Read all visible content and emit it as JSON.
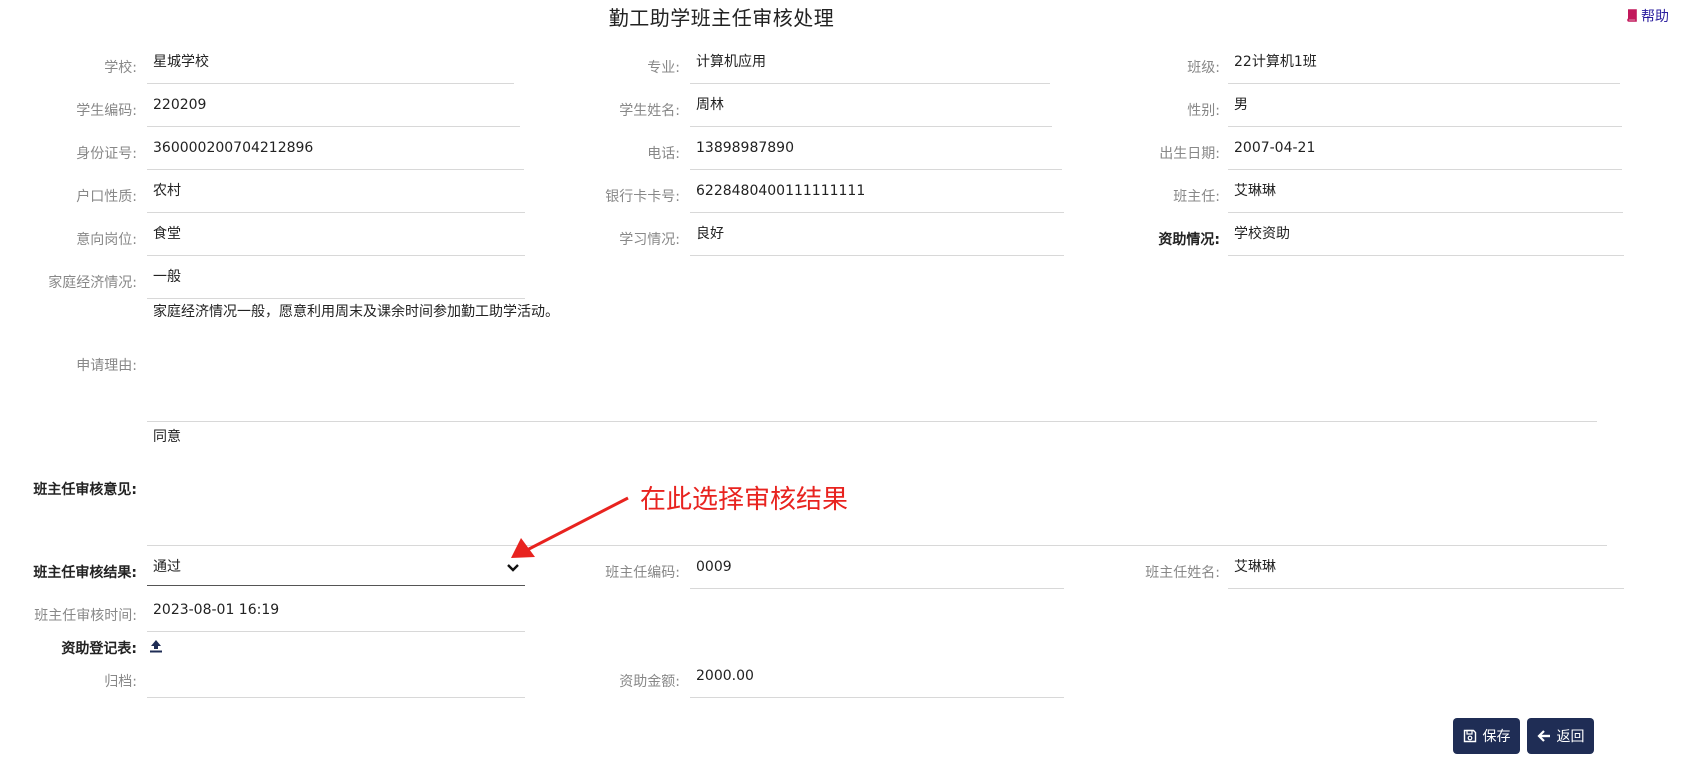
{
  "page": {
    "title": "勤工助学班主任审核处理",
    "help_label": "帮助"
  },
  "fields": {
    "school": {
      "label": "学校:",
      "value": "星城学校"
    },
    "major": {
      "label": "专业:",
      "value": "计算机应用"
    },
    "class": {
      "label": "班级:",
      "value": "22计算机1班"
    },
    "student_id": {
      "label": "学生编码:",
      "value": "220209"
    },
    "student_name": {
      "label": "学生姓名:",
      "value": "周林"
    },
    "gender": {
      "label": "性别:",
      "value": "男"
    },
    "id_card": {
      "label": "身份证号:",
      "value": "360000200704212896"
    },
    "phone": {
      "label": "电话:",
      "value": "13898987890"
    },
    "birth_date": {
      "label": "出生日期:",
      "value": "2007-04-21"
    },
    "hukou": {
      "label": "户口性质:",
      "value": "农村"
    },
    "bank_card": {
      "label": "银行卡卡号:",
      "value": "6228480400111111111"
    },
    "head_teacher": {
      "label": "班主任:",
      "value": "艾琳琳"
    },
    "intended_post": {
      "label": "意向岗位:",
      "value": "食堂"
    },
    "study_status": {
      "label": "学习情况:",
      "value": "良好"
    },
    "aid_status": {
      "label": "资助情况:",
      "value": "学校资助"
    },
    "family_economy": {
      "label": "家庭经济情况:",
      "value": "一般"
    },
    "reason": {
      "label": "申请理由:",
      "value": "家庭经济情况一般，愿意利用周末及课余时间参加勤工助学活动。"
    },
    "review_opinion": {
      "label": "班主任审核意见:",
      "value": "同意"
    },
    "review_result": {
      "label": "班主任审核结果:",
      "value": "通过"
    },
    "teacher_code": {
      "label": "班主任编码:",
      "value": "0009"
    },
    "teacher_name": {
      "label": "班主任姓名:",
      "value": "艾琳琳"
    },
    "review_time": {
      "label": "班主任审核时间:",
      "value": "2023-08-01 16:19"
    },
    "aid_form": {
      "label": "资助登记表:"
    },
    "archive": {
      "label": "归档:",
      "value": ""
    },
    "aid_amount": {
      "label": "资助金额:",
      "value": "2000.00"
    }
  },
  "annotation": {
    "text": "在此选择审核结果"
  },
  "buttons": {
    "save": "保存",
    "back": "返回"
  },
  "colors": {
    "primary_button": "#1f2d55",
    "annotation": "#e8231f",
    "help_link": "#2a1d9e"
  },
  "icons": [
    "help-book-icon",
    "chevron-down-icon",
    "upload-icon",
    "save-icon",
    "arrow-left-icon"
  ]
}
